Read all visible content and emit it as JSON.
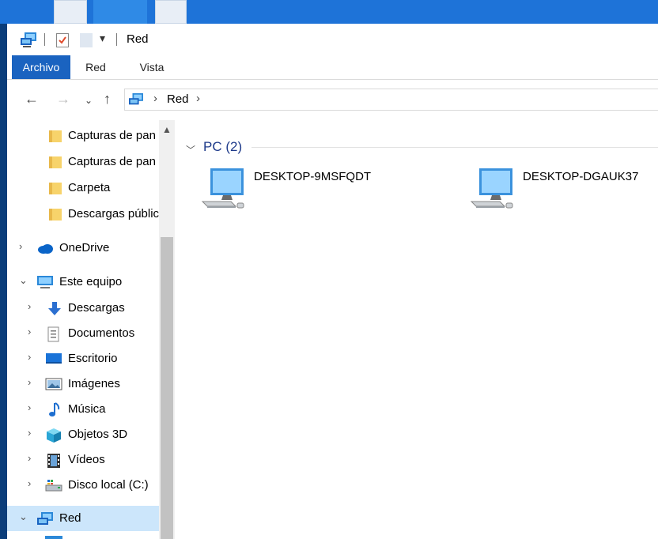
{
  "window": {
    "title": "Red"
  },
  "ribbon": {
    "tabs": [
      {
        "label": "Archivo"
      },
      {
        "label": "Red"
      },
      {
        "label": "Vista"
      }
    ]
  },
  "address": {
    "path": "Red"
  },
  "nav": {
    "items": [
      {
        "label": "Capturas de pan",
        "icon": "folder-icon"
      },
      {
        "label": "Capturas de pan",
        "icon": "folder-icon"
      },
      {
        "label": "Carpeta",
        "icon": "folder-icon"
      },
      {
        "label": "Descargas públic",
        "icon": "folder-icon"
      },
      {
        "label": "OneDrive",
        "icon": "cloud-icon"
      },
      {
        "label": "Este equipo",
        "icon": "pc-icon"
      },
      {
        "label": "Descargas",
        "icon": "download-icon"
      },
      {
        "label": "Documentos",
        "icon": "document-icon"
      },
      {
        "label": "Escritorio",
        "icon": "desktop-icon"
      },
      {
        "label": "Imágenes",
        "icon": "images-icon"
      },
      {
        "label": "Música",
        "icon": "music-icon"
      },
      {
        "label": "Objetos 3D",
        "icon": "cube-icon"
      },
      {
        "label": "Vídeos",
        "icon": "video-icon"
      },
      {
        "label": "Disco local (C:)",
        "icon": "drive-icon"
      },
      {
        "label": "Red",
        "icon": "network-icon"
      }
    ]
  },
  "content": {
    "group": {
      "label": "PC (2)"
    },
    "computers": [
      {
        "name": "DESKTOP-9MSFQDT"
      },
      {
        "name": "DESKTOP-DGAUK37"
      }
    ]
  },
  "colors": {
    "accent": "#1a63c0",
    "selected": "#cce6fb",
    "group_header": "#1e3a8a",
    "folder": "#f7d36b"
  }
}
